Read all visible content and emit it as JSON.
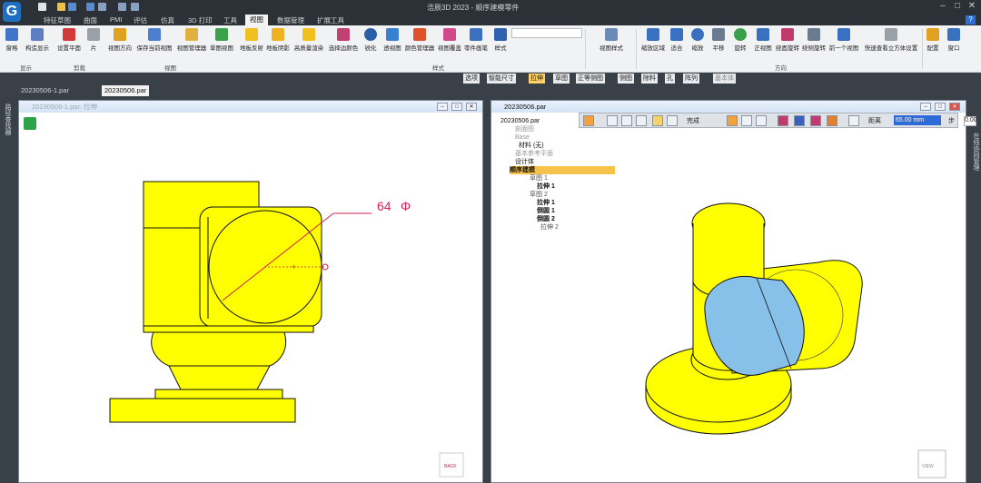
{
  "window": {
    "title": "浩辰3D 2023 - 顺序建模零件"
  },
  "menu_tabs": [
    "特征草图",
    "曲面",
    "PMI",
    "评估",
    "仿真",
    "3D 打印",
    "工具",
    "视图",
    "数据管理",
    "扩展工具"
  ],
  "active_menu_tab": "视图",
  "ribbon": {
    "buttons": [
      {
        "label": "窗格",
        "icon": "pane-icon",
        "color": "#3f74c8"
      },
      {
        "label": "构造显示",
        "icon": "construction-display-icon",
        "color": "#5e7ec0"
      },
      {
        "label": "设置平面",
        "icon": "set-plane-icon",
        "color": "#d23b3b"
      },
      {
        "label": "片",
        "icon": "sheet-icon",
        "color": "#9aa0a8"
      },
      {
        "label": "视图方向",
        "icon": "view-orientation-icon",
        "color": "#e0a020"
      },
      {
        "label": "保存当前视图",
        "icon": "save-view-icon",
        "color": "#4a7fd0"
      },
      {
        "label": "视图管理器",
        "icon": "view-manager-icon",
        "color": "#e0b040"
      },
      {
        "label": "草图视图",
        "icon": "sketch-view-icon",
        "color": "#3aa04a"
      },
      {
        "label": "地板反射",
        "icon": "floor-reflection-icon",
        "color": "#f0c020"
      },
      {
        "label": "地板阴影",
        "icon": "floor-shadow-icon",
        "color": "#f0b020"
      },
      {
        "label": "高质量渲染",
        "icon": "high-quality-render-icon",
        "color": "#f0c020"
      },
      {
        "label": "选择边颜色",
        "icon": "edge-color-icon",
        "color": "#c04070"
      },
      {
        "label": "锐化",
        "icon": "sharpen-icon",
        "color": "#2a5fa8"
      },
      {
        "label": "透视图",
        "icon": "perspective-icon",
        "color": "#3a80d0"
      },
      {
        "label": "颜色管理器",
        "icon": "color-manager-icon",
        "color": "#e0502a"
      },
      {
        "label": "视图覆盖",
        "icon": "view-override-icon",
        "color": "#d04a8a"
      },
      {
        "label": "零件画笔",
        "icon": "part-painter-icon",
        "color": "#3a70c0"
      },
      {
        "label": "样式",
        "icon": "style-icon",
        "color": "#2f60b0"
      },
      {
        "label": "视图样式",
        "icon": "view-style-icon",
        "color": "#6a8ab8"
      },
      {
        "label": "缩放区域",
        "icon": "zoom-area-icon",
        "color": "#3a70c0"
      },
      {
        "label": "适合",
        "icon": "fit-icon",
        "color": "#3a70c0"
      },
      {
        "label": "缩放",
        "icon": "zoom-icon",
        "color": "#3a70c0"
      },
      {
        "label": "平移",
        "icon": "pan-icon",
        "color": "#6a7a90"
      },
      {
        "label": "旋转",
        "icon": "rotate-icon",
        "color": "#3aa04a"
      },
      {
        "label": "正视图",
        "icon": "front-view-icon",
        "color": "#3a70c0"
      },
      {
        "label": "绕面旋转",
        "icon": "rotate-about-face-icon",
        "color": "#c03a6a"
      },
      {
        "label": "绕侧旋转",
        "icon": "rotate-about-side-icon",
        "color": "#6a7a90"
      },
      {
        "label": "前一个视图",
        "icon": "previous-view-icon",
        "color": "#3a70c0"
      },
      {
        "label": "快速查看立方体设置",
        "icon": "view-cube-settings-icon",
        "color": "#9aa0a8"
      },
      {
        "label": "配置",
        "icon": "configuration-icon",
        "color": "#e0a020"
      },
      {
        "label": "窗口",
        "icon": "window-icon",
        "color": "#3a70c0"
      }
    ],
    "groups": [
      "显示",
      "剪裁",
      "视图",
      "样式",
      "方向"
    ]
  },
  "command_bar": [
    "选项",
    "智能尺寸",
    "拉伸",
    "草图",
    "正等侧图",
    "侧图",
    "除料",
    "孔",
    "阵列",
    "基本体"
  ],
  "active_command": "拉伸",
  "doc_tabs": [
    "20230506-1.par",
    "20230506.par"
  ],
  "left_strip_label": "路径查找器",
  "right_strip_label": "在线协同管理",
  "left_window": {
    "title": "20230506-1.par: 拉伸",
    "dimension": "64",
    "dimension_symbol": "Φ",
    "view_cube_label": "BACK"
  },
  "right_window": {
    "title": "20230506.par",
    "view_cube_label": "VIEW"
  },
  "tree": [
    {
      "label": "20230506.par",
      "depth": 0
    },
    {
      "label": "剖面图",
      "depth": 1
    },
    {
      "label": "Base",
      "depth": 1
    },
    {
      "label": "材料 (无)",
      "depth": 1
    },
    {
      "label": "基本参考平面",
      "depth": 1
    },
    {
      "label": "设计体",
      "depth": 1
    },
    {
      "label": "顺序建模",
      "depth": 1,
      "highlight": true
    },
    {
      "label": "草图 1",
      "depth": 2
    },
    {
      "label": "拉伸 1",
      "depth": 2
    },
    {
      "label": "草图 2",
      "depth": 2
    },
    {
      "label": "拉伸 1",
      "depth": 2
    },
    {
      "label": "倒圆 1",
      "depth": 2
    },
    {
      "label": "倒圆 2",
      "depth": 2
    },
    {
      "label": "拉伸 2",
      "depth": 2
    }
  ],
  "extrude_bar": {
    "finish_label": "完成",
    "distance_label": "距离",
    "distance_value": "65.00 mm",
    "step_label": "步",
    "step_value": "0.00"
  },
  "colors": {
    "part_yellow": "#ffff00",
    "part_outline": "#111111",
    "selection_blue": "#87c1ea",
    "dimension_red": "#d91f4f",
    "tree_highlight": "#f6c24a"
  }
}
